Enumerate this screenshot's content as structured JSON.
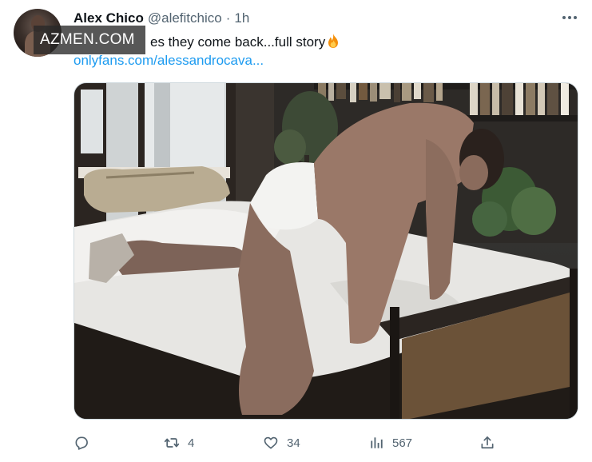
{
  "tweet": {
    "author_name": "Alex Chico",
    "handle": "@alefitchico",
    "separator": "·",
    "time": "1h",
    "text": "es they come back...full story",
    "link_text": "onlyfans.com/alessandrocava...",
    "watermark": "AZMEN.COM"
  },
  "actions": {
    "reply_count": "",
    "retweet_count": "4",
    "like_count": "34",
    "views_count": "567"
  },
  "colors": {
    "link": "#1d9bf0",
    "muted": "#536471",
    "text": "#0f1419"
  },
  "icons": {
    "more": "more-horizontal-icon",
    "reply": "reply-icon",
    "retweet": "retweet-icon",
    "like": "heart-icon",
    "views": "views-icon",
    "share": "share-icon",
    "emoji": "fire-emoji-icon"
  }
}
